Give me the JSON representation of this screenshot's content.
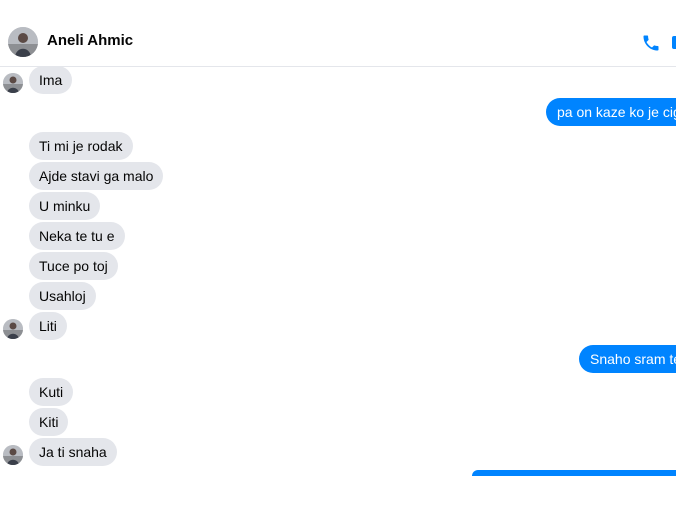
{
  "header": {
    "contact_name": "Aneli Ahmic",
    "call_icon": "phone-icon",
    "video_icon": "video-camera-icon"
  },
  "colors": {
    "accent": "#0084ff",
    "incoming_bubble": "#e4e6eb",
    "text": "#050505"
  },
  "messages": [
    {
      "direction": "incoming",
      "text": "Ima",
      "avatar": true
    },
    {
      "direction": "outgoing",
      "text": "pa on kaze ko je cigan"
    },
    {
      "direction": "incoming",
      "text": "Ti mi je rodak"
    },
    {
      "direction": "incoming",
      "text": "Ajde stavi ga malo"
    },
    {
      "direction": "incoming",
      "text": "U minku"
    },
    {
      "direction": "incoming",
      "text": "Neka te tu e"
    },
    {
      "direction": "incoming",
      "text": "Tuce po toj"
    },
    {
      "direction": "incoming",
      "text": "Usahloj"
    },
    {
      "direction": "incoming",
      "text": "Liti",
      "avatar": true
    },
    {
      "direction": "outgoing",
      "text": "Snaho sram te"
    },
    {
      "direction": "incoming",
      "text": "Kuti"
    },
    {
      "direction": "incoming",
      "text": "Kiti"
    },
    {
      "direction": "incoming",
      "text": "Ja ti snaha",
      "avatar": true
    },
    {
      "direction": "outgoing",
      "text": ""
    }
  ]
}
